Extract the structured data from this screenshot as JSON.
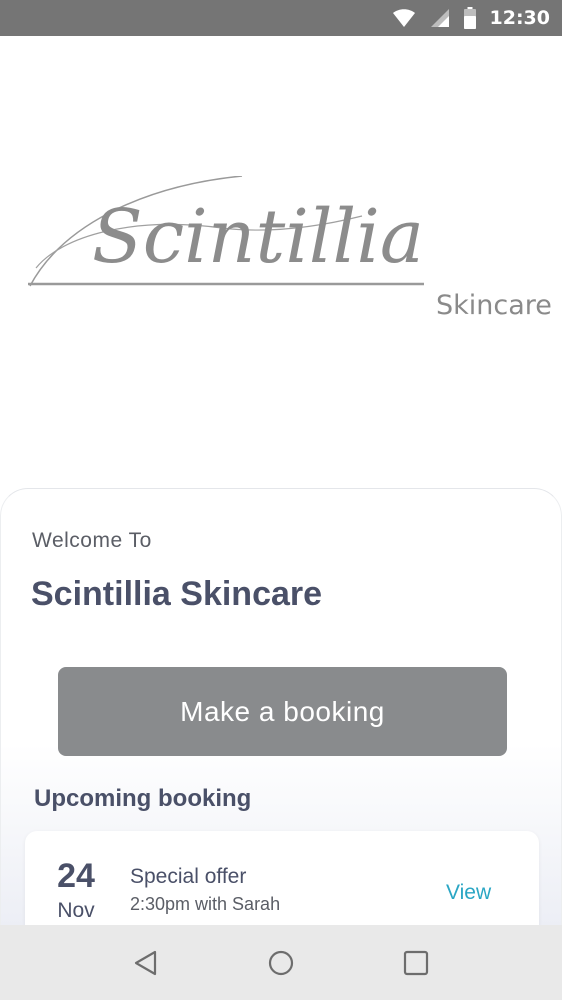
{
  "status_bar": {
    "time": "12:30",
    "icons": [
      "wifi-icon",
      "signal-icon",
      "battery-icon"
    ]
  },
  "logo": {
    "script_text": "Scintillia",
    "suffix_text": "Skincare"
  },
  "welcome": {
    "greeting": "Welcome To",
    "business_name": "Scintillia Skincare"
  },
  "actions": {
    "booking_label": "Make a booking"
  },
  "upcoming": {
    "heading": "Upcoming booking",
    "items": [
      {
        "day": "24",
        "month": "Nov",
        "service": "Special offer",
        "detail": "2:30pm with Sarah",
        "action_label": "View"
      }
    ]
  },
  "nav": {
    "icons": [
      "back-icon",
      "home-icon",
      "recents-icon"
    ]
  },
  "colors": {
    "status_bar": "#757575",
    "primary_text": "#4a5068",
    "button": "#898b8d",
    "link": "#2aa6c4",
    "nav_bar": "#e9e9e9"
  }
}
